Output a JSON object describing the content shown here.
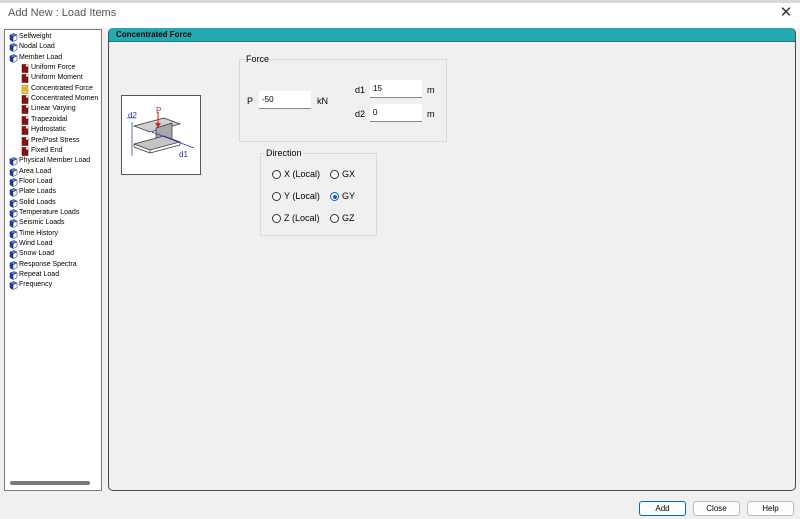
{
  "window": {
    "title": "Add New : Load Items",
    "close_label": "✕"
  },
  "tree": {
    "items": [
      {
        "label": "Selfweight",
        "level": 0,
        "icon": "book-icon"
      },
      {
        "label": "Nodal Load",
        "level": 0,
        "icon": "book-icon"
      },
      {
        "label": "Member Load",
        "level": 0,
        "icon": "book-icon"
      },
      {
        "label": "Uniform Force",
        "level": 1,
        "icon": "page-icon"
      },
      {
        "label": "Uniform Moment",
        "level": 1,
        "icon": "page-icon"
      },
      {
        "label": "Concentrated Force",
        "level": 1,
        "icon": "page-selected-icon",
        "selected": true
      },
      {
        "label": "Concentrated Momen",
        "level": 1,
        "icon": "page-icon"
      },
      {
        "label": "Linear Varying",
        "level": 1,
        "icon": "page-icon"
      },
      {
        "label": "Trapezoidal",
        "level": 1,
        "icon": "page-icon"
      },
      {
        "label": "Hydrostatic",
        "level": 1,
        "icon": "page-icon"
      },
      {
        "label": "Pre/Post Stress",
        "level": 1,
        "icon": "page-icon"
      },
      {
        "label": "Fixed End",
        "level": 1,
        "icon": "page-icon"
      },
      {
        "label": "Physical Member Load",
        "level": 0,
        "icon": "book-icon"
      },
      {
        "label": "Area Load",
        "level": 0,
        "icon": "book-icon"
      },
      {
        "label": "Floor Load",
        "level": 0,
        "icon": "book-icon"
      },
      {
        "label": "Plate Loads",
        "level": 0,
        "icon": "book-icon"
      },
      {
        "label": "Solid Loads",
        "level": 0,
        "icon": "book-icon"
      },
      {
        "label": "Temperature Loads",
        "level": 0,
        "icon": "book-icon"
      },
      {
        "label": "Seismic Loads",
        "level": 0,
        "icon": "book-icon"
      },
      {
        "label": "Time History",
        "level": 0,
        "icon": "book-icon"
      },
      {
        "label": "Wind Load",
        "level": 0,
        "icon": "book-icon"
      },
      {
        "label": "Snow Load",
        "level": 0,
        "icon": "book-icon"
      },
      {
        "label": "Response Spectra",
        "level": 0,
        "icon": "book-icon"
      },
      {
        "label": "Repeat Load",
        "level": 0,
        "icon": "book-icon"
      },
      {
        "label": "Frequency",
        "level": 0,
        "icon": "book-icon"
      }
    ]
  },
  "panel": {
    "header": "Concentrated Force"
  },
  "diagram": {
    "label_p": "P",
    "label_d1": "d1",
    "label_d2": "d2"
  },
  "force": {
    "group_label": "Force",
    "p_label": "P",
    "p_value": "-50",
    "p_unit": "kN",
    "d1_label": "d1",
    "d1_value": "15",
    "d1_unit": "m",
    "d2_label": "d2",
    "d2_value": "0",
    "d2_unit": "m"
  },
  "direction": {
    "group_label": "Direction",
    "options": [
      {
        "label": "X (Local)",
        "selected": false
      },
      {
        "label": "GX",
        "selected": false
      },
      {
        "label": "Y (Local)",
        "selected": false
      },
      {
        "label": "GY",
        "selected": true
      },
      {
        "label": "Z (Local)",
        "selected": false
      },
      {
        "label": "GZ",
        "selected": false
      }
    ]
  },
  "buttons": {
    "add": "Add",
    "close": "Close",
    "help": "Help"
  },
  "colors": {
    "header_bg": "#22a9b2",
    "radio_selected": "#1160c0",
    "book_icon": "#1a3fa8",
    "page_icon": "#8b1010"
  }
}
